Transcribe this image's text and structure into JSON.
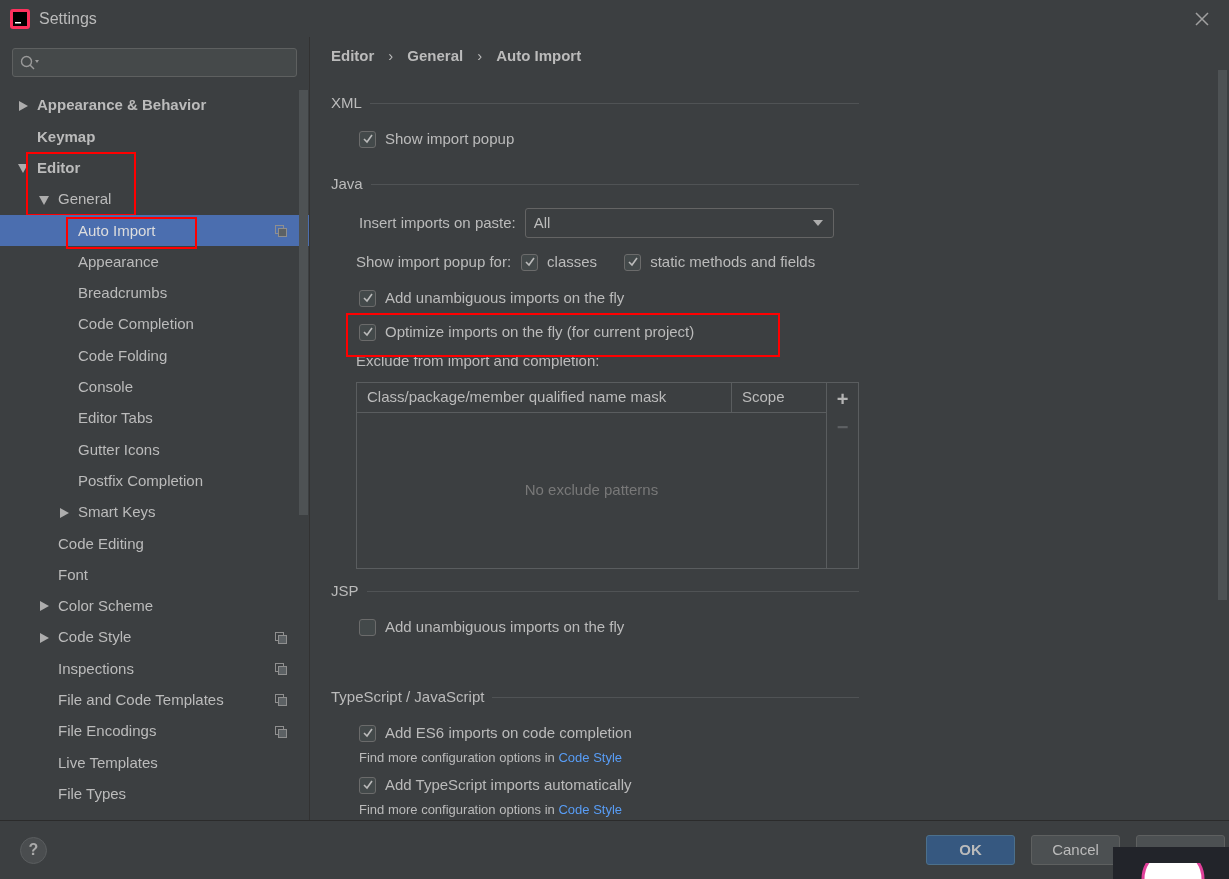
{
  "window": {
    "title": "Settings"
  },
  "sidebar": {
    "tree": [
      {
        "label": "Appearance & Behavior",
        "bold": true,
        "expanded": false,
        "has_children": true,
        "selected": false,
        "annotated": false,
        "project_icon": false
      },
      {
        "label": "Keymap",
        "bold": true,
        "has_children": false,
        "selected": false,
        "annotated": false,
        "project_icon": false
      },
      {
        "label": "Editor",
        "bold": true,
        "expanded": true,
        "has_children": true,
        "selected": false,
        "annotated": true,
        "project_icon": false,
        "children": [
          {
            "label": "General",
            "bold": false,
            "expanded": true,
            "has_children": true,
            "selected": false,
            "annotated": false,
            "project_icon": false,
            "children": [
              {
                "label": "Auto Import",
                "bold": false,
                "has_children": false,
                "selected": true,
                "annotated": true,
                "project_icon": true
              },
              {
                "label": "Appearance",
                "bold": false,
                "has_children": false,
                "selected": false,
                "annotated": false,
                "project_icon": false
              },
              {
                "label": "Breadcrumbs",
                "bold": false,
                "has_children": false,
                "selected": false,
                "annotated": false,
                "project_icon": false
              },
              {
                "label": "Code Completion",
                "bold": false,
                "has_children": false,
                "selected": false,
                "annotated": false,
                "project_icon": false
              },
              {
                "label": "Code Folding",
                "bold": false,
                "has_children": false,
                "selected": false,
                "annotated": false,
                "project_icon": false
              },
              {
                "label": "Console",
                "bold": false,
                "has_children": false,
                "selected": false,
                "annotated": false,
                "project_icon": false
              },
              {
                "label": "Editor Tabs",
                "bold": false,
                "has_children": false,
                "selected": false,
                "annotated": false,
                "project_icon": false
              },
              {
                "label": "Gutter Icons",
                "bold": false,
                "has_children": false,
                "selected": false,
                "annotated": false,
                "project_icon": false
              },
              {
                "label": "Postfix Completion",
                "bold": false,
                "has_children": false,
                "selected": false,
                "annotated": false,
                "project_icon": false
              },
              {
                "label": "Smart Keys",
                "bold": false,
                "expanded": false,
                "has_children": true,
                "selected": false,
                "annotated": false,
                "project_icon": false
              }
            ]
          },
          {
            "label": "Code Editing",
            "bold": false,
            "has_children": false,
            "selected": false,
            "annotated": false,
            "project_icon": false
          },
          {
            "label": "Font",
            "bold": false,
            "has_children": false,
            "selected": false,
            "annotated": false,
            "project_icon": false
          },
          {
            "label": "Color Scheme",
            "bold": false,
            "expanded": false,
            "has_children": true,
            "selected": false,
            "annotated": false,
            "project_icon": false
          },
          {
            "label": "Code Style",
            "bold": false,
            "expanded": false,
            "has_children": true,
            "selected": false,
            "annotated": false,
            "project_icon": true
          },
          {
            "label": "Inspections",
            "bold": false,
            "has_children": false,
            "selected": false,
            "annotated": false,
            "project_icon": true
          },
          {
            "label": "File and Code Templates",
            "bold": false,
            "has_children": false,
            "selected": false,
            "annotated": false,
            "project_icon": true
          },
          {
            "label": "File Encodings",
            "bold": false,
            "has_children": false,
            "selected": false,
            "annotated": false,
            "project_icon": true
          },
          {
            "label": "Live Templates",
            "bold": false,
            "has_children": false,
            "selected": false,
            "annotated": false,
            "project_icon": false
          },
          {
            "label": "File Types",
            "bold": false,
            "has_children": false,
            "selected": false,
            "annotated": false,
            "project_icon": false
          }
        ]
      }
    ]
  },
  "breadcrumb": {
    "items": [
      "Editor",
      "General",
      "Auto Import"
    ],
    "separator": "›"
  },
  "help": {
    "label": "?"
  },
  "sections": [
    {
      "title": "XML",
      "items": [
        {
          "kind": "checkbox",
          "label": "Show import popup",
          "checked": true,
          "annotated": false
        }
      ]
    },
    {
      "title": "Java",
      "items": [
        {
          "kind": "dropdown",
          "label": "Insert imports on paste:",
          "value": "All"
        },
        {
          "kind": "checkbox-group",
          "label": "Show import popup for:",
          "options": [
            {
              "label": "classes",
              "checked": true
            },
            {
              "label": "static methods and fields",
              "checked": true
            }
          ]
        },
        {
          "kind": "checkbox",
          "label": "Add unambiguous imports on the fly",
          "checked": true,
          "annotated": false
        },
        {
          "kind": "checkbox",
          "label": "Optimize imports on the fly (for current project)",
          "checked": true,
          "annotated": true
        },
        {
          "kind": "table",
          "label": "Exclude from import and completion:",
          "columns": [
            "Class/package/member qualified name mask",
            "Scope"
          ],
          "empty_text": "No exclude patterns",
          "actions": [
            {
              "label": "+",
              "disabled": false
            },
            {
              "label": "−",
              "disabled": true
            }
          ]
        }
      ]
    },
    {
      "title": "JSP",
      "items": [
        {
          "kind": "checkbox",
          "label": "Add unambiguous imports on the fly",
          "checked": false,
          "annotated": false
        }
      ]
    },
    {
      "title": "TypeScript / JavaScript",
      "items": [
        {
          "kind": "checkbox",
          "label": "Add ES6 imports on code completion",
          "checked": true,
          "annotated": false
        },
        {
          "kind": "hint",
          "text": "Find more configuration options in",
          "link": "Code Style"
        },
        {
          "kind": "checkbox",
          "label": "Add TypeScript imports automatically",
          "checked": true,
          "annotated": false
        },
        {
          "kind": "hint",
          "text": "Find more configuration options in",
          "link": "Code Style"
        }
      ]
    }
  ],
  "buttons": [
    {
      "label": "OK",
      "primary": true
    },
    {
      "label": "Cancel",
      "primary": false
    },
    {
      "primary": false
    }
  ]
}
